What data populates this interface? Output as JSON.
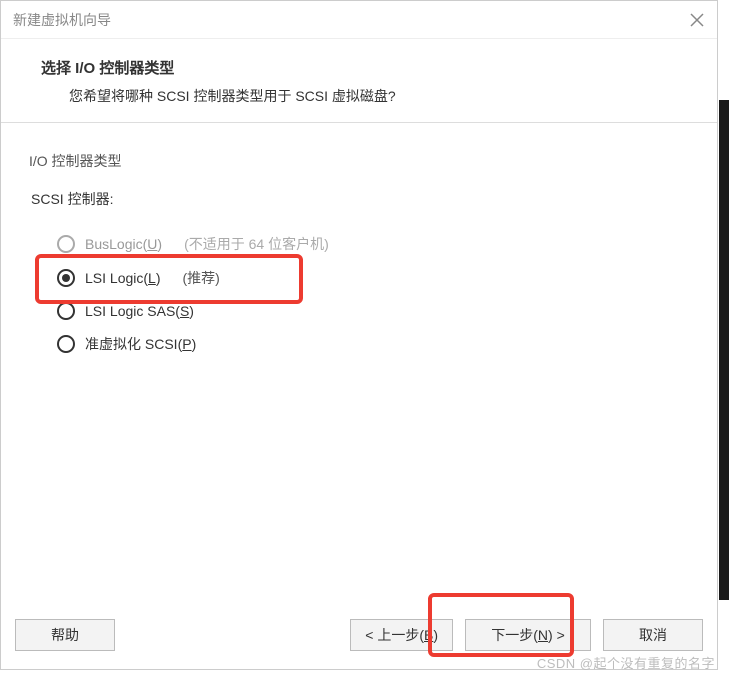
{
  "titlebar": {
    "title": "新建虚拟机向导"
  },
  "header": {
    "title": "选择 I/O 控制器类型",
    "subtitle": "您希望将哪种 SCSI 控制器类型用于 SCSI 虚拟磁盘?"
  },
  "content": {
    "section_title": "I/O 控制器类型",
    "group_label": "SCSI 控制器:",
    "options": {
      "buslogic": {
        "prefix": "BusLogic(",
        "u": "U",
        "suffix": ")",
        "note": "(不适用于 64 位客户机)"
      },
      "lsilogic": {
        "prefix": "LSI Logic(",
        "u": "L",
        "suffix": ")",
        "note": "(推荐)"
      },
      "lsisas": {
        "prefix": "LSI Logic SAS(",
        "u": "S",
        "suffix": ")"
      },
      "pvscsi": {
        "prefix": "准虚拟化 SCSI(",
        "u": "P",
        "suffix": ")"
      }
    }
  },
  "footer": {
    "help": "帮助",
    "back_prefix": "< 上一步(",
    "back_u": "B",
    "back_suffix": ")",
    "next_prefix": "下一步(",
    "next_u": "N",
    "next_suffix": ") >",
    "cancel": "取消"
  },
  "watermark": "CSDN @起个没有重复的名字"
}
